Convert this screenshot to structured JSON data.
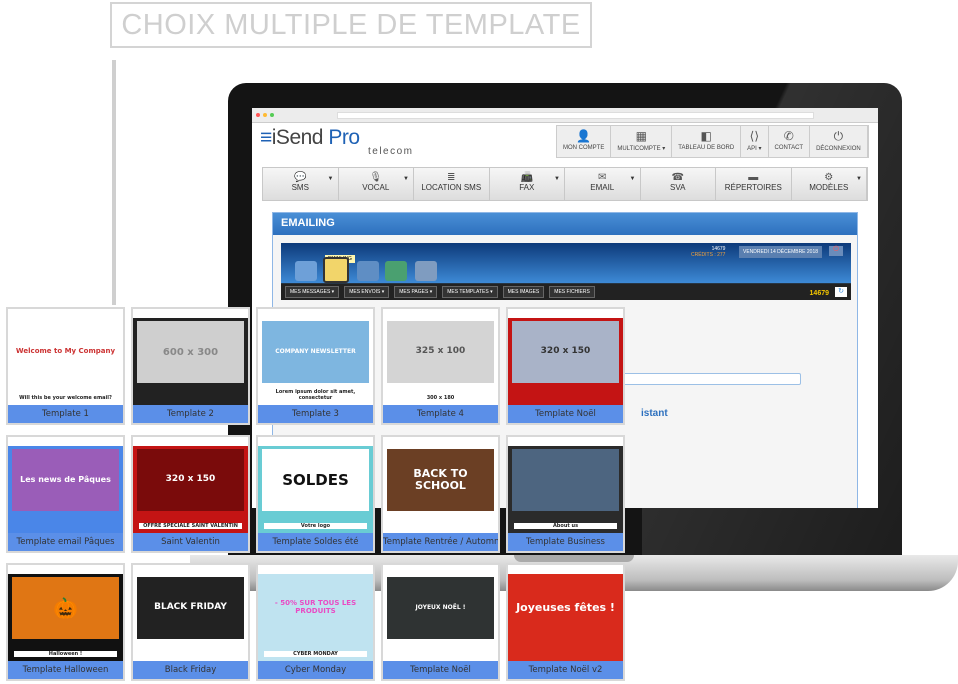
{
  "title": "CHOIX MULTIPLE DE TEMPLATE",
  "app": {
    "logo_main": "iSend",
    "logo_pro": "Pro",
    "logo_sub": "telecom",
    "top_nav": [
      {
        "label": "MON COMPTE",
        "icon": "user-icon",
        "glyph": "👤"
      },
      {
        "label": "MULTICOMPTE ▾",
        "icon": "building-icon",
        "glyph": "▦"
      },
      {
        "label": "TABLEAU DE BORD",
        "icon": "dashboard-icon",
        "glyph": "◧"
      },
      {
        "label": "API ▾",
        "icon": "code-file-icon",
        "glyph": "⟨⟩"
      },
      {
        "label": "CONTACT",
        "icon": "phone-icon",
        "glyph": "✆"
      },
      {
        "label": "DÉCONNEXION",
        "icon": "power-icon",
        "glyph": "⏻"
      }
    ],
    "menu": [
      {
        "label": "SMS",
        "icon": "chat-icon",
        "glyph": "💬",
        "dropdown": true
      },
      {
        "label": "VOCAL",
        "icon": "microphone-icon",
        "glyph": "🎙",
        "dropdown": true
      },
      {
        "label": "LOCATION SMS",
        "icon": "database-icon",
        "glyph": "≣",
        "dropdown": false
      },
      {
        "label": "FAX",
        "icon": "fax-icon",
        "glyph": "📠",
        "dropdown": true
      },
      {
        "label": "EMAIL",
        "icon": "envelope-icon",
        "glyph": "✉",
        "dropdown": true
      },
      {
        "label": "SVA",
        "icon": "phone-keypad-icon",
        "glyph": "☎",
        "dropdown": false
      },
      {
        "label": "RÉPERTOIRES",
        "icon": "folder-icon",
        "glyph": "▬",
        "dropdown": false
      },
      {
        "label": "MODÈLES",
        "icon": "gear-icon",
        "glyph": "⚙",
        "dropdown": true
      }
    ],
    "panel_title": "EMAILING",
    "active_tab": "EMAILING",
    "credits_count": "14679",
    "credits_label": "CRÉDITS : 277",
    "date": "VENDREDI 14 DÉCEMBRE 2018",
    "sub_nav": [
      "MES MESSAGES ▾",
      "MES ENVOIS ▾",
      "MES PAGES ▾",
      "MES TEMPLATES ▾",
      "MES IMAGES",
      "MES FICHIERS"
    ],
    "counter": "14679",
    "partial_text": "istant"
  },
  "templates": [
    {
      "label": "Template 1",
      "bg": "#ffffff",
      "hero_bg": "#ffffff",
      "hero": "Welcome to My Company",
      "hero_color": "#c33",
      "hero_size": 7,
      "caption": "Will this be your welcome email?"
    },
    {
      "label": "Template 2",
      "bg": "#222222",
      "hero_bg": "#cfcfcf",
      "hero": "600 x 300",
      "hero_color": "#888",
      "hero_size": 10,
      "caption": ""
    },
    {
      "label": "Template 3",
      "bg": "#ffffff",
      "hero_bg": "#7eb6e0",
      "hero": "COMPANY NEWSLETTER",
      "hero_color": "#fff",
      "hero_size": 6,
      "caption": "Lorem ipsum dolor sit amet, consectetur"
    },
    {
      "label": "Template 4",
      "bg": "#ffffff",
      "hero_bg": "#d4d4d4",
      "hero": "325 x 100",
      "hero_color": "#555",
      "hero_size": 9,
      "caption": "300 x 180"
    },
    {
      "label": "Template Noël",
      "bg": "#c41414",
      "hero_bg": "#a9b3c8",
      "hero": "320 x 150",
      "hero_color": "#333",
      "hero_size": 9,
      "caption": ""
    },
    {
      "label": "Template email Pâques",
      "bg": "#4a86e8",
      "hero_bg": "#9a5db8",
      "hero": "Les news de Pâques",
      "hero_color": "#fff",
      "hero_size": 8,
      "caption": ""
    },
    {
      "label": "Saint Valentin",
      "bg": "#c41414",
      "hero_bg": "#7a0b0b",
      "hero": "320 x 150",
      "hero_color": "#fff",
      "hero_size": 9,
      "caption": "OFFRE SPECIALE SAINT VALENTIN"
    },
    {
      "label": "Template Soldes été",
      "bg": "#69ccd4",
      "hero_bg": "#ffffff",
      "hero": "SOLDES",
      "hero_color": "#111",
      "hero_size": 15,
      "caption": "Votre logo"
    },
    {
      "label": "Template Rentrée / Automne",
      "bg": "#ffffff",
      "hero_bg": "#6b3f24",
      "hero": "BACK TO SCHOOL",
      "hero_color": "#fff",
      "hero_size": 11,
      "caption": ""
    },
    {
      "label": "Template Business",
      "bg": "#2b2b2b",
      "hero_bg": "#4d6580",
      "hero": "",
      "hero_color": "#fff",
      "hero_size": 9,
      "caption": "About us"
    },
    {
      "label": "Template Halloween",
      "bg": "#111111",
      "hero_bg": "#e07614",
      "hero": "🎃",
      "hero_color": "#000",
      "hero_size": 20,
      "caption": "Halloween !"
    },
    {
      "label": "Black Friday",
      "bg": "#ffffff",
      "hero_bg": "#222222",
      "hero": "BLACK FRIDAY",
      "hero_color": "#fff",
      "hero_size": 9,
      "caption": ""
    },
    {
      "label": "Cyber Monday",
      "bg": "#bfe3f0",
      "hero_bg": "#bfe3f0",
      "hero": "- 50% SUR TOUS LES PRODUITS",
      "hero_color": "#e94bc4",
      "hero_size": 7,
      "caption": "CYBER MONDAY"
    },
    {
      "label": "Template Noël",
      "bg": "#ffffff",
      "hero_bg": "#2f3333",
      "hero": "JOYEUX NOËL !",
      "hero_color": "#fff",
      "hero_size": 6,
      "caption": ""
    },
    {
      "label": "Template Noël v2",
      "bg": "#d92a1c",
      "hero_bg": "#d92a1c",
      "hero": "Joyeuses fêtes !",
      "hero_color": "#fff",
      "hero_size": 11,
      "caption": ""
    }
  ],
  "colors": {
    "label_bar": "#5b8fe8",
    "brand_blue": "#1f62b5",
    "panel_blue": "#2d70be"
  }
}
